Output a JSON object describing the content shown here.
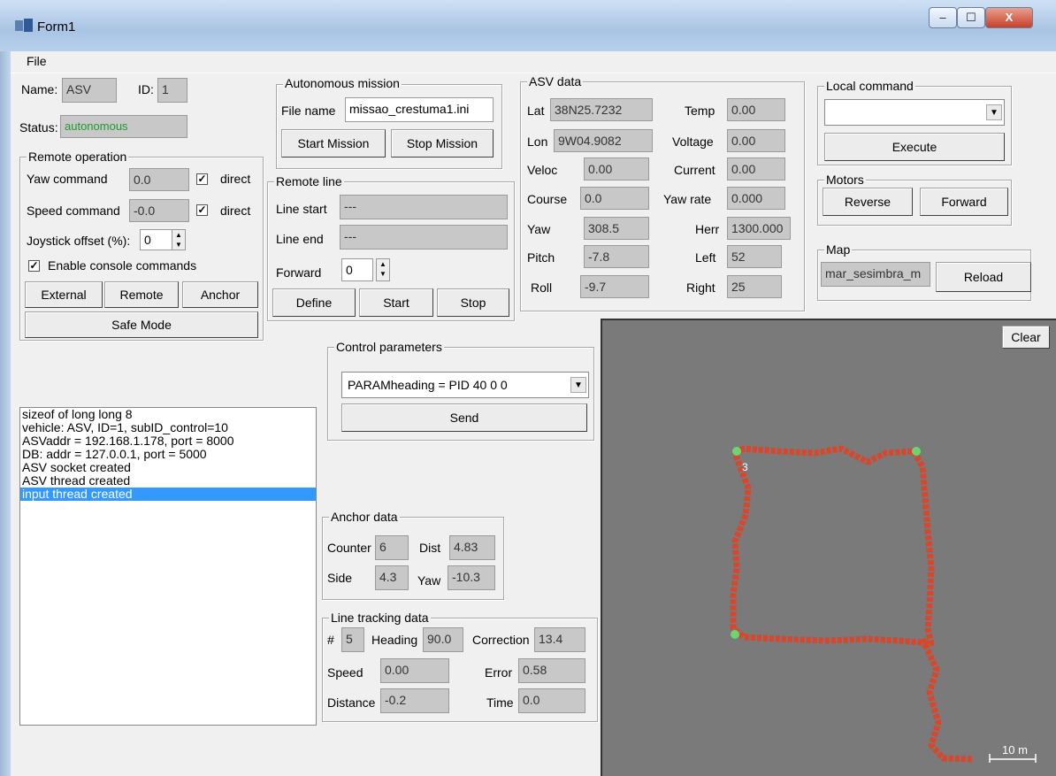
{
  "window": {
    "title": "Form1",
    "minimize": "–",
    "maximize": "☐",
    "close": "X"
  },
  "menu": {
    "file": "File"
  },
  "status": {
    "name_label": "Name:",
    "name_value": "ASV",
    "id_label": "ID:",
    "id_value": "1",
    "status_label": "Status:",
    "status_value": "autonomous"
  },
  "remote_operation": {
    "title": "Remote operation",
    "yaw_label": "Yaw command",
    "yaw_value": "0.0",
    "yaw_direct": "direct",
    "speed_label": "Speed command",
    "speed_value": "-0.0",
    "speed_direct": "direct",
    "joystick_label": "Joystick offset (%):",
    "joystick_value": "0",
    "console_label": "Enable console commands",
    "external": "External",
    "remote": "Remote",
    "anchor": "Anchor",
    "safe_mode": "Safe Mode"
  },
  "autonomous_mission": {
    "title": "Autonomous mission",
    "file_label": "File name",
    "file_value": "missao_crestuma1.ini",
    "start": "Start Mission",
    "stop": "Stop Mission"
  },
  "remote_line": {
    "title": "Remote line",
    "start_label": "Line start",
    "start_value": "---",
    "end_label": "Line end",
    "end_value": "---",
    "forward_label": "Forward",
    "forward_value": "0",
    "define": "Define",
    "start": "Start",
    "stop": "Stop"
  },
  "asv_data": {
    "title": "ASV data",
    "lat_label": "Lat",
    "lat": "38N25.7232",
    "lon_label": "Lon",
    "lon": "9W04.9082",
    "veloc_label": "Veloc",
    "veloc": "0.00",
    "course_label": "Course",
    "course": "0.0",
    "yaw_label": "Yaw",
    "yaw": "308.5",
    "pitch_label": "Pitch",
    "pitch": "-7.8",
    "roll_label": "Roll",
    "roll": "-9.7",
    "temp_label": "Temp",
    "temp": "0.00",
    "voltage_label": "Voltage",
    "voltage": "0.00",
    "current_label": "Current",
    "current": "0.00",
    "yawrate_label": "Yaw rate",
    "yawrate": "0.000",
    "herr_label": "Herr",
    "herr": "1300.000",
    "left_label": "Left",
    "left": "52",
    "right_label": "Right",
    "right": "25"
  },
  "local_command": {
    "title": "Local command",
    "value": "",
    "execute": "Execute"
  },
  "motors": {
    "title": "Motors",
    "reverse": "Reverse",
    "forward": "Forward"
  },
  "map_box": {
    "title": "Map",
    "value": "mar_sesimbra_m",
    "reload": "Reload"
  },
  "control_parameters": {
    "title": "Control parameters",
    "value": "PARAMheading = PID 40 0 0",
    "send": "Send"
  },
  "log": [
    "sizeof of long long 8",
    "vehicle: ASV, ID=1, subID_control=10",
    "ASVaddr = 192.168.1.178, port = 8000",
    "DB: addr = 127.0.0.1, port = 5000",
    "ASV socket created",
    "ASV thread created",
    "input thread created"
  ],
  "anchor_data": {
    "title": "Anchor data",
    "counter_label": "Counter",
    "counter": "6",
    "dist_label": "Dist",
    "dist": "4.83",
    "side_label": "Side",
    "side": "4.3",
    "yaw_label": "Yaw",
    "yaw": "-10.3"
  },
  "line_tracking": {
    "title": "Line tracking data",
    "num_label": "#",
    "num": "5",
    "heading_label": "Heading",
    "heading": "90.0",
    "correction_label": "Correction",
    "correction": "13.4",
    "speed_label": "Speed",
    "speed": "0.00",
    "error_label": "Error",
    "error": "0.58",
    "distance_label": "Distance",
    "distance": "-0.2",
    "time_label": "Time",
    "time": "0.0"
  },
  "mapview": {
    "clear": "Clear",
    "scale": "10 m",
    "waypoint": "3",
    "track_color": "#d8462c",
    "background": "#7a7a7a"
  }
}
